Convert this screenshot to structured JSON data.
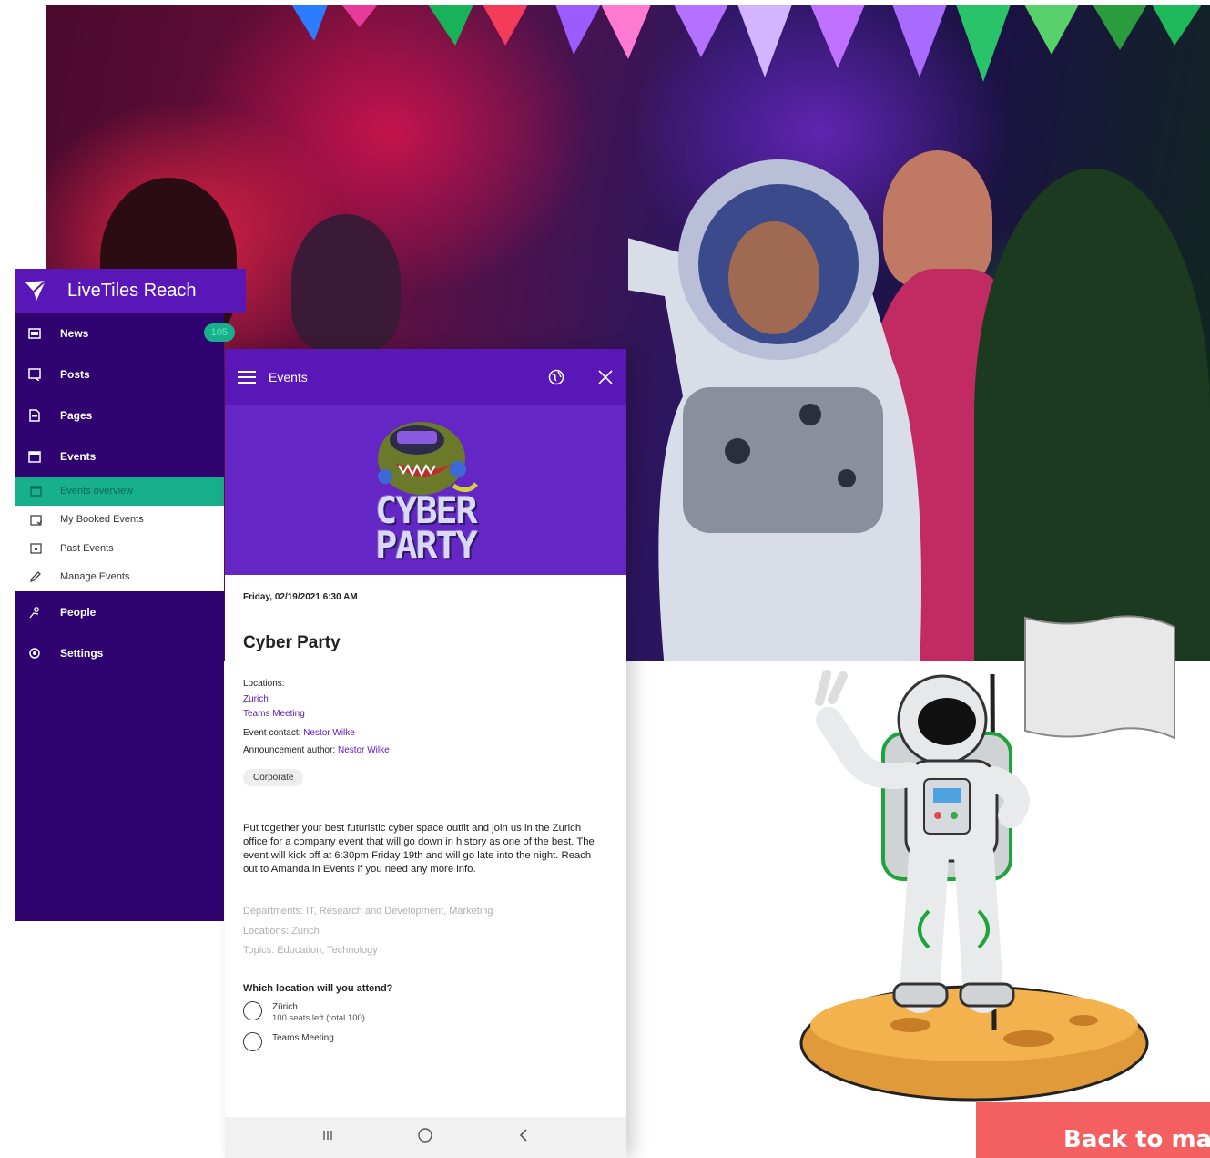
{
  "sidebar": {
    "brand_name": "LiveTiles Reach",
    "items": [
      {
        "label": "News",
        "icon": "news-icon",
        "badge": "105"
      },
      {
        "label": "Posts",
        "icon": "posts-icon"
      },
      {
        "label": "Pages",
        "icon": "pages-icon"
      },
      {
        "label": "Events",
        "icon": "events-icon"
      }
    ],
    "subitems": [
      {
        "label": "Events overview",
        "icon": "calendar-icon",
        "active": true
      },
      {
        "label": "My Booked Events",
        "icon": "calendar-check-icon"
      },
      {
        "label": "Past Events",
        "icon": "calendar-past-icon"
      },
      {
        "label": "Manage Events",
        "icon": "pencil-icon"
      }
    ],
    "bottom_items": [
      {
        "label": "People",
        "icon": "people-icon"
      },
      {
        "label": "Settings",
        "icon": "gear-icon"
      }
    ]
  },
  "panel": {
    "title": "Events",
    "hero_logo": {
      "line1": "CYBER",
      "line2": "PARTY"
    },
    "date": "Friday, 02/19/2021 6:30 AM",
    "event_title": "Cyber Party",
    "locations_label": "Locations:",
    "locations": [
      "Zurich",
      "Teams Meeting"
    ],
    "contact_label": "Event contact:",
    "contact_name": "Nestor Wilke",
    "author_label": "Announcement author:",
    "author_name": "Nestor Wilke",
    "tag": "Corporate",
    "description": "Put together your best futuristic cyber space outfit and join us in the Zurich office for a company event that will go down in history as one of the best. The event will kick off at 6:30pm Friday 19th and will go late into the night. Reach out to Amanda in Events if you need any more info.",
    "meta": [
      "Departments: IT, Research and Development, Marketing",
      "Locations: Zurich",
      "Topics: Education, Technology"
    ],
    "question": "Which location will you attend?",
    "options": [
      {
        "label": "Zürich",
        "sub": "100 seats left (total 100)"
      },
      {
        "label": "Teams Meeting",
        "sub": ""
      }
    ]
  },
  "back_button": "Back to main",
  "colors": {
    "brand_purple": "#5a17b7",
    "sidebar_dark": "#2f0471",
    "accent_green": "#17b08a",
    "cta_red": "#f4605f"
  }
}
